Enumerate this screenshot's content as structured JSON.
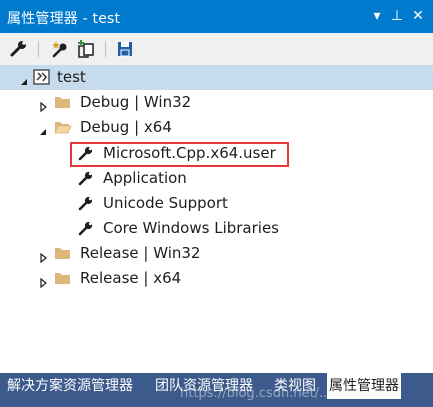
{
  "window": {
    "title": "属性管理器 - test",
    "dropdown_glyph": "▾",
    "pin_glyph": "⊥",
    "close_glyph": "✕"
  },
  "toolbar": {
    "buttons": [
      "properties-wrench",
      "add-new-property-sheet",
      "add-existing-property-sheet",
      "save"
    ]
  },
  "tree": {
    "root": "test",
    "items": [
      {
        "label": "Debug | Win32",
        "expanded": false
      },
      {
        "label": "Debug | x64",
        "expanded": true,
        "children": [
          "Microsoft.Cpp.x64.user",
          "Application",
          "Unicode Support",
          "Core Windows Libraries"
        ]
      },
      {
        "label": "Release | Win32",
        "expanded": false
      },
      {
        "label": "Release | x64",
        "expanded": false
      }
    ]
  },
  "tabs": [
    "解决方案资源管理器",
    "团队资源管理器",
    "类视图",
    "属性管理器"
  ],
  "active_tab": "属性管理器",
  "watermark": "https://blog.csdn.net/...26",
  "colors": {
    "titlebar": "#007acc",
    "selected_row": "#c6dcee",
    "highlight_border": "#e8383a",
    "tabbar": "#3c5a8c"
  }
}
